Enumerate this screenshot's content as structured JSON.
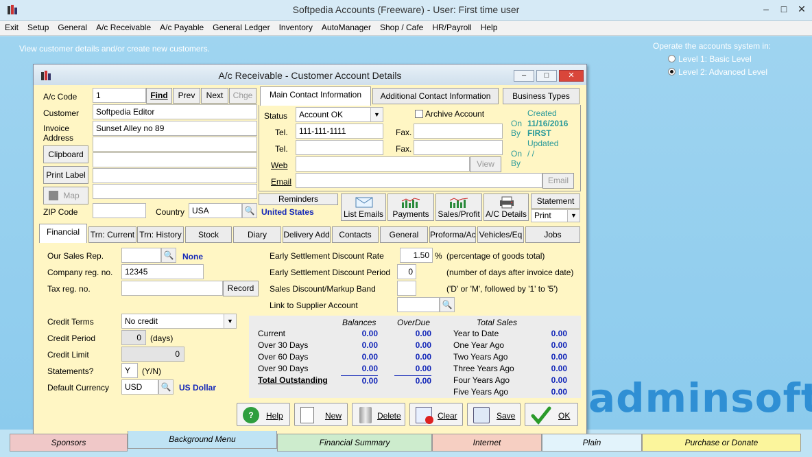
{
  "window": {
    "title": "Softpedia Accounts (Freeware)  -  User: First time user"
  },
  "menu": [
    "Exit",
    "Setup",
    "General",
    "A/c Receivable",
    "A/c Payable",
    "General Ledger",
    "Inventory",
    "AutoManager",
    "Shop / Cafe",
    "HR/Payroll",
    "Help"
  ],
  "desk": {
    "hint": "View customer details and/or create new customers.",
    "levels_title": "Operate the accounts system in:",
    "level1": "Level 1: Basic Level",
    "level2": "Level 2: Advanced Level",
    "brand": "adminsoft"
  },
  "dialog": {
    "title": "A/c Receivable  -  Customer Account Details",
    "ac_code_label": "A/c Code",
    "ac_code": "1",
    "find": "Find",
    "prev": "Prev",
    "next": "Next",
    "chge": "Chge",
    "customer_label": "Customer",
    "customer": "Softpedia Editor",
    "invoice_label": "Invoice",
    "address_label": "Address",
    "address1": "Sunset Alley no 89",
    "clipboard": "Clipboard",
    "print_label": "Print Label",
    "map": "Map",
    "zip_label": "ZIP Code",
    "country_label": "Country",
    "country": "USA",
    "country_name": "United States",
    "tabs_top": [
      "Main Contact Information",
      "Additional Contact Information",
      "Business Types"
    ],
    "status_label": "Status",
    "status": "Account OK",
    "archive": "Archive Account",
    "tel_label": "Tel.",
    "tel1": "111-111-1111",
    "fax_label": "Fax.",
    "web_label": "Web",
    "view": "View",
    "email_label": "Email",
    "email_btn": "Email",
    "created_label": "Created",
    "on_label": "On",
    "created_on": "11/16/2016",
    "by_label": "By",
    "created_by": "FIRST",
    "updated_label": "Updated",
    "updated_on": "/  /",
    "reminders": "Reminders",
    "action_buttons": [
      "List Emails",
      "Payments",
      "Sales/Profit",
      "A/C Details"
    ],
    "statement": "Statement",
    "statement_mode": "Print",
    "tabs_mid": [
      "Financial",
      "Trn: Current",
      "Trn: History",
      "Stock",
      "Diary",
      "Delivery Add",
      "Contacts",
      "General",
      "Proforma/Ac",
      "Vehicles/Eq",
      "Jobs"
    ],
    "sales_rep_label": "Our Sales Rep.",
    "sales_rep": "None",
    "company_reg_label": "Company reg. no.",
    "company_reg": "12345",
    "tax_reg_label": "Tax reg. no.",
    "record": "Record",
    "credit_terms_label": "Credit Terms",
    "credit_terms": "No credit",
    "credit_period_label": "Credit Period",
    "credit_period": "0",
    "days": "(days)",
    "credit_limit_label": "Credit Limit",
    "credit_limit": "0",
    "statements_label": "Statements?",
    "statements": "Y",
    "yn": "(Y/N)",
    "currency_label": "Default Currency",
    "currency": "USD",
    "currency_name": "US Dollar",
    "esd_rate_label": "Early Settlement Discount Rate",
    "esd_rate": "1.50",
    "pct": "%",
    "esd_rate_note": "(percentage of goods total)",
    "esd_period_label": "Early Settlement Discount Period",
    "esd_period": "0",
    "esd_period_note": "(number of days after invoice date)",
    "band_label": "Sales Discount/Markup Band",
    "band_note": "('D' or 'M', followed by '1' to '5')",
    "supplier_label": "Link to Supplier Account",
    "balances_head": "Balances",
    "overdue_head": "OverDue",
    "totalsales_head": "Total Sales",
    "aging": [
      {
        "label": "Current",
        "bal": "0.00",
        "od": "0.00"
      },
      {
        "label": "Over 30 Days",
        "bal": "0.00",
        "od": "0.00"
      },
      {
        "label": "Over 60 Days",
        "bal": "0.00",
        "od": "0.00"
      },
      {
        "label": "Over 90 Days",
        "bal": "0.00",
        "od": "0.00"
      },
      {
        "label": "Total Outstanding",
        "bal": "0.00",
        "od": "0.00"
      }
    ],
    "sales": [
      {
        "label": "Year to Date",
        "val": "0.00"
      },
      {
        "label": "One Year Ago",
        "val": "0.00"
      },
      {
        "label": "Two Years Ago",
        "val": "0.00"
      },
      {
        "label": "Three Years Ago",
        "val": "0.00"
      },
      {
        "label": "Four Years Ago",
        "val": "0.00"
      },
      {
        "label": "Five Years Ago",
        "val": "0.00"
      }
    ],
    "bottom_buttons": [
      "Help",
      "New",
      "Delete",
      "Clear",
      "Save",
      "OK"
    ]
  },
  "bottom_tabs": [
    "Sponsors",
    "Background Menu",
    "Financial Summary",
    "Internet",
    "Plain",
    "Purchase or Donate"
  ]
}
